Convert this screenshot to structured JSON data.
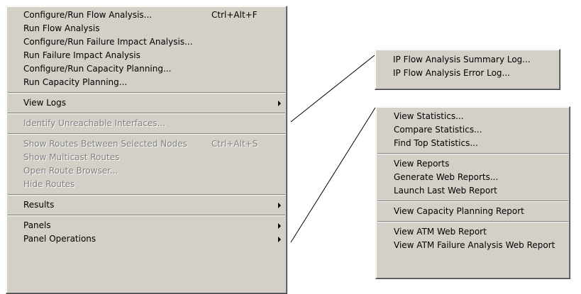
{
  "main_menu": {
    "items": [
      {
        "label": "Configure/Run Flow Analysis...",
        "shortcut": "Ctrl+Alt+F"
      },
      {
        "label": "Run Flow Analysis"
      },
      {
        "label": "Configure/Run Failure Impact Analysis..."
      },
      {
        "label": "Run Failure Impact Analysis"
      },
      {
        "label": "Configure/Run Capacity Planning..."
      },
      {
        "label": "Run Capacity Planning..."
      },
      {
        "label": "View Logs"
      },
      {
        "label": "Identify Unreachable Interfaces..."
      },
      {
        "label": "Show Routes Between Selected Nodes",
        "shortcut": "Ctrl+Alt+S"
      },
      {
        "label": "Show Multicast Routes"
      },
      {
        "label": "Open Route Browser..."
      },
      {
        "label": "Hide Routes"
      },
      {
        "label": "Results"
      },
      {
        "label": "Panels"
      },
      {
        "label": "Panel Operations"
      }
    ]
  },
  "logs_submenu": {
    "items": [
      {
        "label": "IP Flow Analysis Summary Log..."
      },
      {
        "label": "IP Flow Analysis Error Log..."
      }
    ]
  },
  "results_submenu": {
    "items": [
      {
        "label": "View Statistics..."
      },
      {
        "label": "Compare Statistics..."
      },
      {
        "label": "Find Top Statistics..."
      },
      {
        "label": "View Reports"
      },
      {
        "label": "Generate Web Reports..."
      },
      {
        "label": "Launch Last Web Report"
      },
      {
        "label": "View Capacity Planning Report"
      },
      {
        "label": "View ATM Web Report"
      },
      {
        "label": "View ATM Failure Analysis Web Report"
      }
    ]
  },
  "colors": {
    "menu_bg": "#d4d0c8",
    "disabled_text": "#808080",
    "connector": "#000000"
  }
}
